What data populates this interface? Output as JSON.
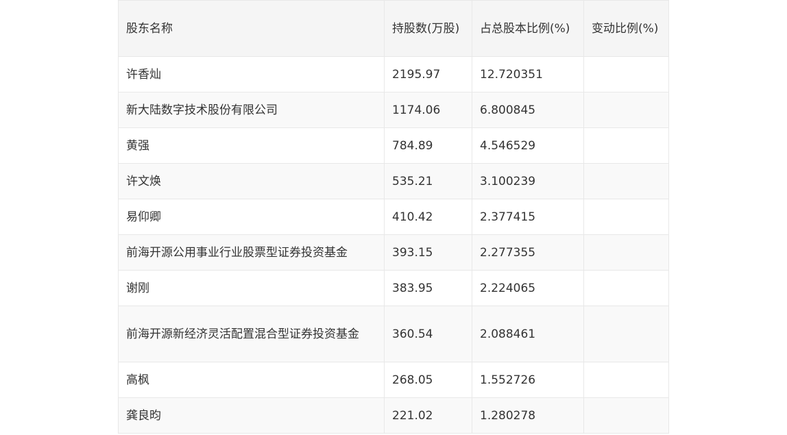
{
  "table": {
    "headers": [
      "股东名称",
      "持股数(万股)",
      "占总股本比例(%)",
      "变动比例(%)"
    ],
    "rows": [
      [
        "许香灿",
        "2195.97",
        "12.720351",
        ""
      ],
      [
        "新大陆数字技术股份有限公司",
        "1174.06",
        "6.800845",
        ""
      ],
      [
        "黄强",
        "784.89",
        "4.546529",
        ""
      ],
      [
        "许文焕",
        "535.21",
        "3.100239",
        ""
      ],
      [
        "易仰卿",
        "410.42",
        "2.377415",
        ""
      ],
      [
        "前海开源公用事业行业股票型证券投资基金",
        "393.15",
        "2.277355",
        ""
      ],
      [
        "谢刚",
        "383.95",
        "2.224065",
        ""
      ],
      [
        "前海开源新经济灵活配置混合型证券投资基金",
        "360.54",
        "2.088461",
        ""
      ],
      [
        "高枫",
        "268.05",
        "1.552726",
        ""
      ],
      [
        "龚良昀",
        "221.02",
        "1.280278",
        ""
      ]
    ]
  }
}
